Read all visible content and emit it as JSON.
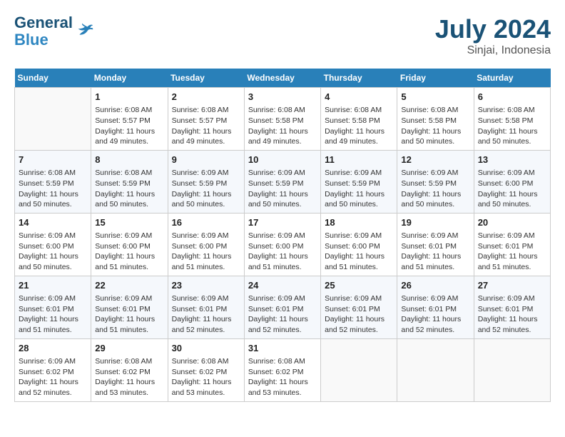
{
  "header": {
    "logo_line1": "General",
    "logo_line2": "Blue",
    "title": "July 2024",
    "subtitle": "Sinjai, Indonesia"
  },
  "calendar": {
    "days_of_week": [
      "Sunday",
      "Monday",
      "Tuesday",
      "Wednesday",
      "Thursday",
      "Friday",
      "Saturday"
    ],
    "weeks": [
      [
        {
          "day": "",
          "content": ""
        },
        {
          "day": "1",
          "content": "Sunrise: 6:08 AM\nSunset: 5:57 PM\nDaylight: 11 hours and 49 minutes."
        },
        {
          "day": "2",
          "content": "Sunrise: 6:08 AM\nSunset: 5:57 PM\nDaylight: 11 hours and 49 minutes."
        },
        {
          "day": "3",
          "content": "Sunrise: 6:08 AM\nSunset: 5:58 PM\nDaylight: 11 hours and 49 minutes."
        },
        {
          "day": "4",
          "content": "Sunrise: 6:08 AM\nSunset: 5:58 PM\nDaylight: 11 hours and 49 minutes."
        },
        {
          "day": "5",
          "content": "Sunrise: 6:08 AM\nSunset: 5:58 PM\nDaylight: 11 hours and 50 minutes."
        },
        {
          "day": "6",
          "content": "Sunrise: 6:08 AM\nSunset: 5:58 PM\nDaylight: 11 hours and 50 minutes."
        }
      ],
      [
        {
          "day": "7",
          "content": "Sunrise: 6:08 AM\nSunset: 5:59 PM\nDaylight: 11 hours and 50 minutes."
        },
        {
          "day": "8",
          "content": "Sunrise: 6:08 AM\nSunset: 5:59 PM\nDaylight: 11 hours and 50 minutes."
        },
        {
          "day": "9",
          "content": "Sunrise: 6:09 AM\nSunset: 5:59 PM\nDaylight: 11 hours and 50 minutes."
        },
        {
          "day": "10",
          "content": "Sunrise: 6:09 AM\nSunset: 5:59 PM\nDaylight: 11 hours and 50 minutes."
        },
        {
          "day": "11",
          "content": "Sunrise: 6:09 AM\nSunset: 5:59 PM\nDaylight: 11 hours and 50 minutes."
        },
        {
          "day": "12",
          "content": "Sunrise: 6:09 AM\nSunset: 5:59 PM\nDaylight: 11 hours and 50 minutes."
        },
        {
          "day": "13",
          "content": "Sunrise: 6:09 AM\nSunset: 6:00 PM\nDaylight: 11 hours and 50 minutes."
        }
      ],
      [
        {
          "day": "14",
          "content": "Sunrise: 6:09 AM\nSunset: 6:00 PM\nDaylight: 11 hours and 50 minutes."
        },
        {
          "day": "15",
          "content": "Sunrise: 6:09 AM\nSunset: 6:00 PM\nDaylight: 11 hours and 51 minutes."
        },
        {
          "day": "16",
          "content": "Sunrise: 6:09 AM\nSunset: 6:00 PM\nDaylight: 11 hours and 51 minutes."
        },
        {
          "day": "17",
          "content": "Sunrise: 6:09 AM\nSunset: 6:00 PM\nDaylight: 11 hours and 51 minutes."
        },
        {
          "day": "18",
          "content": "Sunrise: 6:09 AM\nSunset: 6:00 PM\nDaylight: 11 hours and 51 minutes."
        },
        {
          "day": "19",
          "content": "Sunrise: 6:09 AM\nSunset: 6:01 PM\nDaylight: 11 hours and 51 minutes."
        },
        {
          "day": "20",
          "content": "Sunrise: 6:09 AM\nSunset: 6:01 PM\nDaylight: 11 hours and 51 minutes."
        }
      ],
      [
        {
          "day": "21",
          "content": "Sunrise: 6:09 AM\nSunset: 6:01 PM\nDaylight: 11 hours and 51 minutes."
        },
        {
          "day": "22",
          "content": "Sunrise: 6:09 AM\nSunset: 6:01 PM\nDaylight: 11 hours and 51 minutes."
        },
        {
          "day": "23",
          "content": "Sunrise: 6:09 AM\nSunset: 6:01 PM\nDaylight: 11 hours and 52 minutes."
        },
        {
          "day": "24",
          "content": "Sunrise: 6:09 AM\nSunset: 6:01 PM\nDaylight: 11 hours and 52 minutes."
        },
        {
          "day": "25",
          "content": "Sunrise: 6:09 AM\nSunset: 6:01 PM\nDaylight: 11 hours and 52 minutes."
        },
        {
          "day": "26",
          "content": "Sunrise: 6:09 AM\nSunset: 6:01 PM\nDaylight: 11 hours and 52 minutes."
        },
        {
          "day": "27",
          "content": "Sunrise: 6:09 AM\nSunset: 6:01 PM\nDaylight: 11 hours and 52 minutes."
        }
      ],
      [
        {
          "day": "28",
          "content": "Sunrise: 6:09 AM\nSunset: 6:02 PM\nDaylight: 11 hours and 52 minutes."
        },
        {
          "day": "29",
          "content": "Sunrise: 6:08 AM\nSunset: 6:02 PM\nDaylight: 11 hours and 53 minutes."
        },
        {
          "day": "30",
          "content": "Sunrise: 6:08 AM\nSunset: 6:02 PM\nDaylight: 11 hours and 53 minutes."
        },
        {
          "day": "31",
          "content": "Sunrise: 6:08 AM\nSunset: 6:02 PM\nDaylight: 11 hours and 53 minutes."
        },
        {
          "day": "",
          "content": ""
        },
        {
          "day": "",
          "content": ""
        },
        {
          "day": "",
          "content": ""
        }
      ]
    ]
  }
}
